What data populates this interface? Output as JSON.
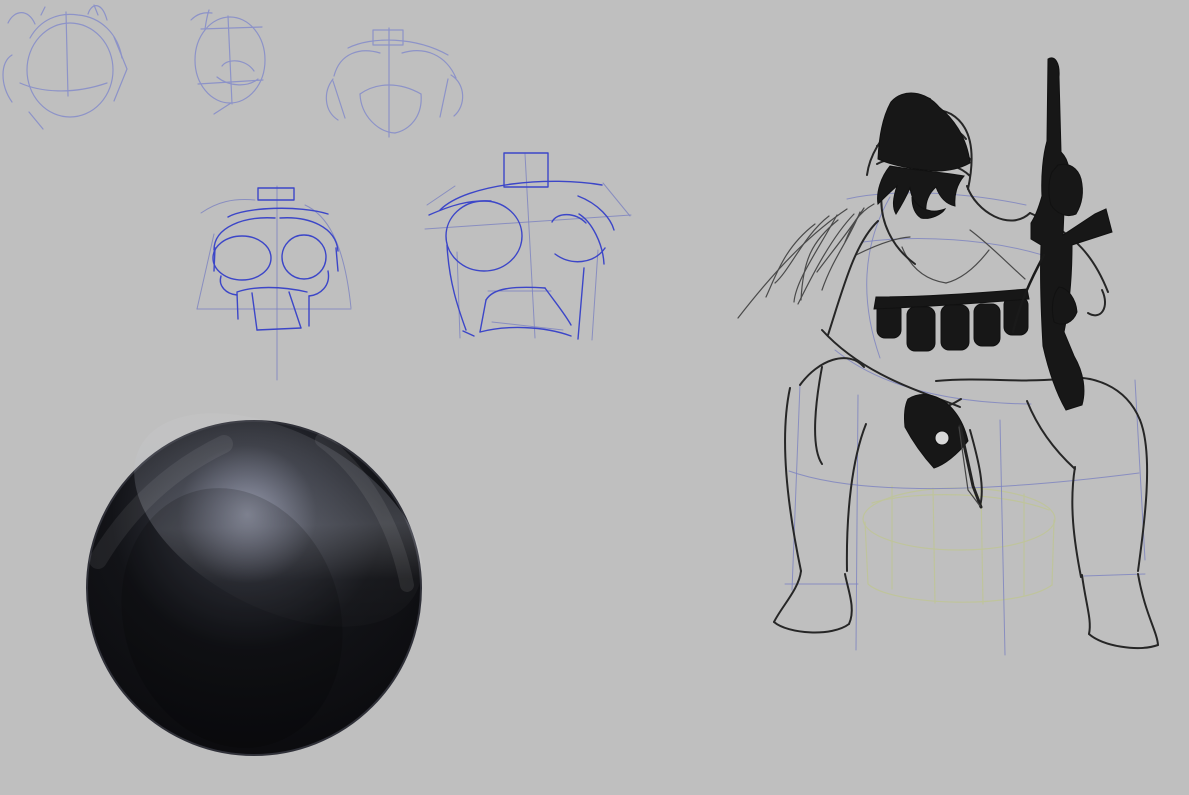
{
  "canvas": {
    "background": "#bfbfbf",
    "sketch_color": "#3c46c8",
    "figure_color": "#1a1a1a"
  },
  "elements": {
    "top_left_sketch": "head-sketch-top-left",
    "top_middle_sketch": "head-sketch-top-middle",
    "top_right_sketch": "head-sketch-top-right",
    "middle_left_sketch": "skull-sketch-middle-left",
    "middle_right_sketch": "skull-sketch-middle-right",
    "sphere": "dark-sphere",
    "figure": "seated-soldier-figure"
  }
}
